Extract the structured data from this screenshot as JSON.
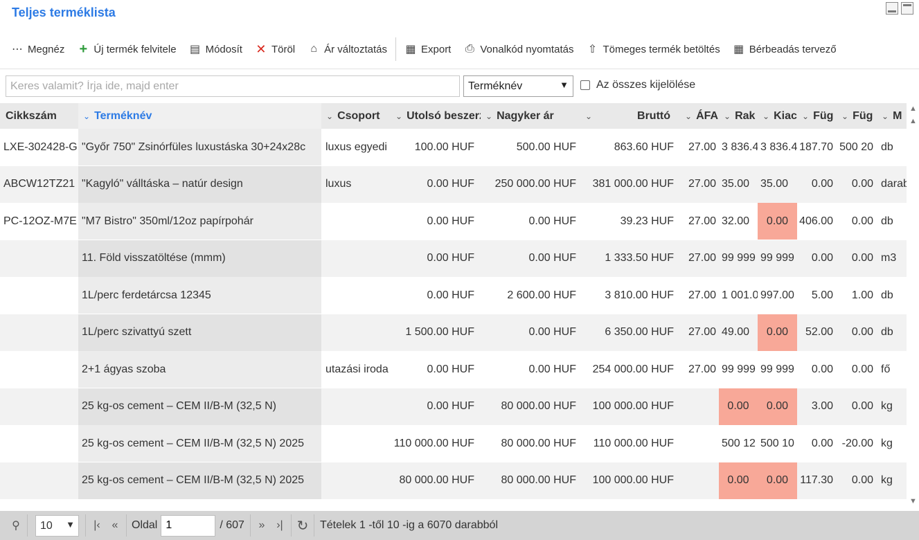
{
  "window": {
    "title": "Teljes terméklista"
  },
  "toolbar": [
    {
      "label": "Megnéz",
      "icon": "more-icon",
      "glyph": "⋯"
    },
    {
      "label": "Új termék felvitele",
      "icon": "plus-icon",
      "glyph": "+"
    },
    {
      "label": "Módosít",
      "icon": "edit-icon",
      "glyph": "▤"
    },
    {
      "label": "Töröl",
      "icon": "delete-icon",
      "glyph": "✕"
    },
    {
      "label": "Ár változtatás",
      "icon": "price-tag-icon",
      "glyph": "⌂"
    },
    {
      "label": "Export",
      "icon": "excel-icon",
      "glyph": "▦"
    },
    {
      "label": "Vonalkód nyomtatás",
      "icon": "printer-icon",
      "glyph": "⎙"
    },
    {
      "label": "Tömeges termék betöltés",
      "icon": "upload-icon",
      "glyph": "⇧"
    },
    {
      "label": "Bérbeadás tervező",
      "icon": "calendar-icon",
      "glyph": "▦"
    }
  ],
  "search": {
    "placeholder": "Keres valamit? Írja ide, majd enter",
    "field_selected": "Terméknév",
    "select_all_label": "Az összes kijelölése"
  },
  "columns": [
    "Cikkszám",
    "Terméknév",
    "Csoport",
    "Utolsó beszerz",
    "Nagyker ár",
    "Bruttó",
    "ÁFA",
    "Rak",
    "Kiac",
    "Füg",
    "Füg",
    "M"
  ],
  "rows": [
    [
      "LXE-302428-G",
      "\"Győr 750\" Zsinórfüles luxustáska 30+24x28c",
      "luxus egyedi",
      "100.00 HUF",
      "500.00 HUF",
      "863.60 HUF",
      "27.00",
      "3 836.4",
      "3 836.4",
      "187.70",
      "500 20",
      "db"
    ],
    [
      "ABCW12TZ21",
      "\"Kagyló\" válltáska – natúr design",
      "luxus",
      "0.00 HUF",
      "250 000.00 HUF",
      "381 000.00 HUF",
      "27.00",
      "35.00",
      "35.00",
      "0.00",
      "0.00",
      "darab"
    ],
    [
      "PC-12OZ-M7E",
      "\"M7 Bistro\" 350ml/12oz papírpohár",
      "",
      "0.00 HUF",
      "0.00 HUF",
      "39.23 HUF",
      "27.00",
      "32.00",
      "0.00",
      "406.00",
      "0.00",
      "db"
    ],
    [
      "",
      "11. Föld visszatöltése (mmm)",
      "",
      "0.00 HUF",
      "0.00 HUF",
      "1 333.50 HUF",
      "27.00",
      "99 999",
      "99 999",
      "0.00",
      "0.00",
      "m3"
    ],
    [
      "",
      "1L/perc ferdetárcsa 12345",
      "",
      "0.00 HUF",
      "2 600.00 HUF",
      "3 810.00 HUF",
      "27.00",
      "1 001.0",
      "997.00",
      "5.00",
      "1.00",
      "db"
    ],
    [
      "",
      "1L/perc szivattyú szett",
      "",
      "1 500.00 HUF",
      "0.00 HUF",
      "6 350.00 HUF",
      "27.00",
      "49.00",
      "0.00",
      "52.00",
      "0.00",
      "db"
    ],
    [
      "",
      "2+1 ágyas szoba",
      "utazási iroda",
      "0.00 HUF",
      "0.00 HUF",
      "254 000.00 HUF",
      "27.00",
      "99 999",
      "99 999",
      "0.00",
      "0.00",
      "fő"
    ],
    [
      "",
      "25 kg-os cement – CEM II/B-M (32,5 N)",
      "",
      "0.00 HUF",
      "80 000.00 HUF",
      "100 000.00 HUF",
      "",
      "0.00",
      "0.00",
      "3.00",
      "0.00",
      "kg"
    ],
    [
      "",
      "25 kg-os cement – CEM II/B-M (32,5 N) 2025",
      "",
      "110 000.00 HUF",
      "80 000.00 HUF",
      "110 000.00 HUF",
      "",
      "500 12",
      "500 10",
      "0.00",
      "-20.00",
      "kg"
    ],
    [
      "",
      "25 kg-os cement – CEM II/B-M (32,5 N) 2025",
      "",
      "80 000.00 HUF",
      "80 000.00 HUF",
      "100 000.00 HUF",
      "",
      "0.00",
      "0.00",
      "117.30",
      "0.00",
      "kg"
    ]
  ],
  "highlighted_cells": [
    [
      2,
      8
    ],
    [
      5,
      8
    ],
    [
      7,
      7
    ],
    [
      7,
      8
    ],
    [
      9,
      7
    ],
    [
      9,
      8
    ]
  ],
  "highlight_color": "#f8a898",
  "pager": {
    "page_size": "10",
    "page_label": "Oldal",
    "current_page": "1",
    "total_pages": "/ 607",
    "summary": "Tételek 1 -től 10 -ig a 6070 darabból"
  }
}
